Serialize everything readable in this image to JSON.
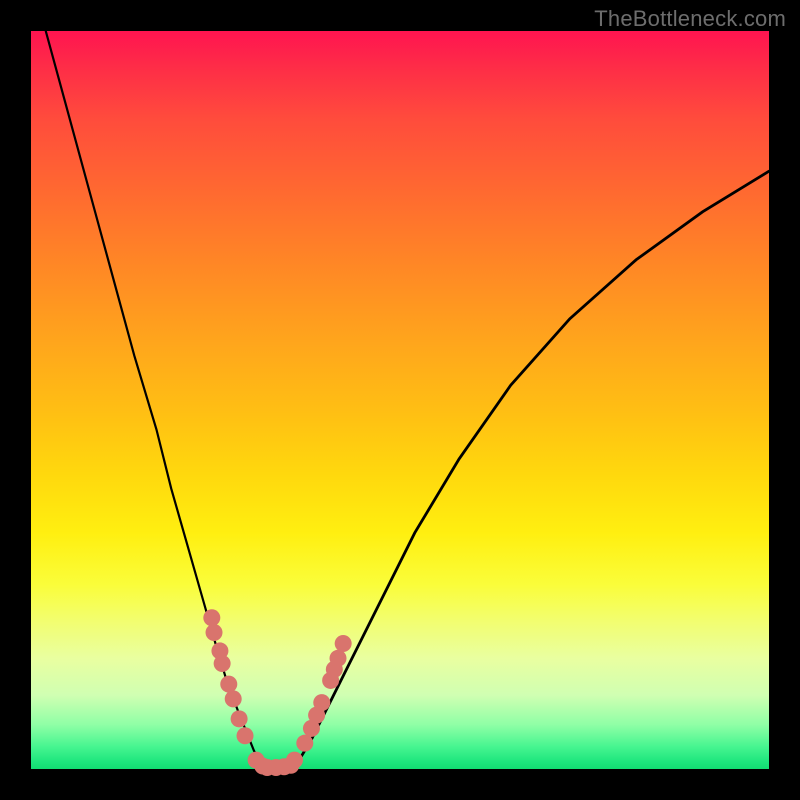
{
  "watermark": "TheBottleneck.com",
  "colors": {
    "dot": "#d9746d",
    "curve": "#000000",
    "frame": "#000000"
  },
  "chart_data": {
    "type": "line",
    "title": "",
    "xlabel": "",
    "ylabel": "",
    "xlim": [
      0,
      100
    ],
    "ylim": [
      0,
      100
    ],
    "series": [
      {
        "name": "left-branch",
        "x": [
          2,
          5,
          8,
          11,
          14,
          17,
          19,
          21,
          23,
          25,
          26.5,
          28,
          29.2,
          30.2,
          31,
          31.8
        ],
        "y": [
          100,
          89,
          78,
          67,
          56,
          46,
          38,
          31,
          24,
          17,
          12,
          8,
          5,
          2.5,
          1,
          0
        ]
      },
      {
        "name": "right-branch",
        "x": [
          35.5,
          36.5,
          38,
          40,
          43,
          47,
          52,
          58,
          65,
          73,
          82,
          91,
          100
        ],
        "y": [
          0,
          1.5,
          4,
          8,
          14,
          22,
          32,
          42,
          52,
          61,
          69,
          75.5,
          81
        ]
      }
    ],
    "points": {
      "name": "highlighted-dots",
      "x": [
        24.5,
        24.8,
        25.6,
        25.9,
        26.8,
        27.4,
        28.2,
        29.0,
        30.5,
        31.4,
        32.0,
        33.2,
        34.3,
        35.2,
        35.7,
        37.1,
        38.0,
        38.7,
        39.4,
        40.6,
        41.1,
        41.6,
        42.3
      ],
      "y": [
        20.5,
        18.5,
        16.0,
        14.3,
        11.5,
        9.5,
        6.8,
        4.5,
        1.2,
        0.4,
        0.2,
        0.2,
        0.3,
        0.5,
        1.2,
        3.5,
        5.5,
        7.3,
        9.0,
        12.0,
        13.5,
        15.0,
        17.0
      ]
    }
  }
}
